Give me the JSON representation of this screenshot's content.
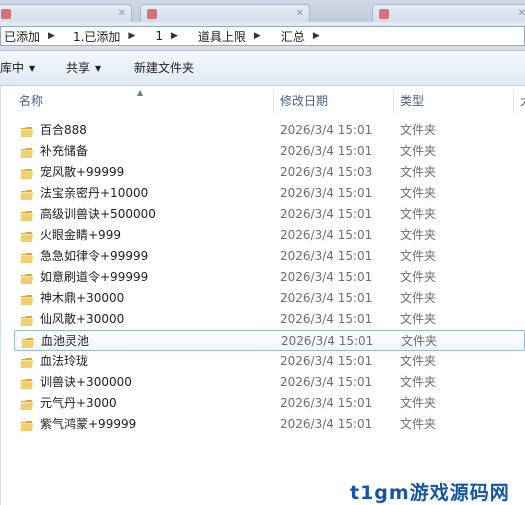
{
  "breadcrumb": [
    "已添加",
    "1.已添加",
    "1",
    "道具上限",
    "汇总"
  ],
  "toolbar": {
    "library": "库中",
    "share": "共享",
    "new_folder": "新建文件夹"
  },
  "columns": {
    "name": "名称",
    "date": "修改日期",
    "type": "类型",
    "size": "大"
  },
  "files": [
    {
      "name": "百合888",
      "date": "2026/3/4 15:01",
      "type": "文件夹"
    },
    {
      "name": "补充储备",
      "date": "2026/3/4 15:01",
      "type": "文件夹"
    },
    {
      "name": "宠风散+99999",
      "date": "2026/3/4 15:03",
      "type": "文件夹"
    },
    {
      "name": "法宝亲密丹+10000",
      "date": "2026/3/4 15:01",
      "type": "文件夹"
    },
    {
      "name": "高级训兽诀+500000",
      "date": "2026/3/4 15:01",
      "type": "文件夹"
    },
    {
      "name": "火眼金睛+999",
      "date": "2026/3/4 15:01",
      "type": "文件夹"
    },
    {
      "name": "急急如律令+99999",
      "date": "2026/3/4 15:01",
      "type": "文件夹"
    },
    {
      "name": "如意刷道令+99999",
      "date": "2026/3/4 15:01",
      "type": "文件夹"
    },
    {
      "name": "神木鼎+30000",
      "date": "2026/3/4 15:01",
      "type": "文件夹"
    },
    {
      "name": "仙风散+30000",
      "date": "2026/3/4 15:01",
      "type": "文件夹"
    },
    {
      "name": "血池灵池",
      "date": "2026/3/4 15:01",
      "type": "文件夹"
    },
    {
      "name": "血法玲珑",
      "date": "2026/3/4 15:01",
      "type": "文件夹"
    },
    {
      "name": "训兽诀+300000",
      "date": "2026/3/4 15:01",
      "type": "文件夹"
    },
    {
      "name": "元气丹+3000",
      "date": "2026/3/4 15:01",
      "type": "文件夹"
    },
    {
      "name": "紫气鸿蒙+99999",
      "date": "2026/3/4 15:01",
      "type": "文件夹"
    }
  ],
  "selected_index": 10,
  "watermark": "t1gm游戏源码网",
  "colors": {
    "folder": "#e8c060",
    "selection_border": "#9ab8db",
    "header_text": "#4c607a",
    "watermark": "#1654a8"
  }
}
